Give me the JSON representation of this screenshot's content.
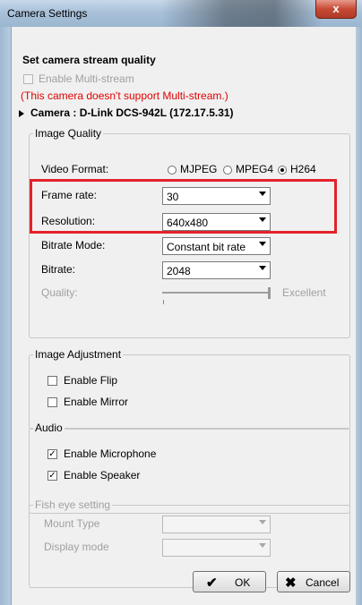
{
  "window": {
    "title": "Camera Settings",
    "close_label": "x"
  },
  "stream": {
    "heading": "Set camera stream quality",
    "multistream_label": "Enable Multi-stream",
    "multistream_warning": "(This camera doesn't support Multi-stream.)",
    "camera_label": "Camera : D-Link DCS-942L (172.17.5.31)"
  },
  "image_quality": {
    "group_title": "Image Quality",
    "video_format_label": "Video Format:",
    "formats": [
      "MJPEG",
      "MPEG4",
      "H264"
    ],
    "selected_format": "H264",
    "frame_rate_label": "Frame rate:",
    "frame_rate_value": "30",
    "resolution_label": "Resolution:",
    "resolution_value": "640x480",
    "bitrate_mode_label": "Bitrate Mode:",
    "bitrate_mode_value": "Constant bit rate",
    "bitrate_label": "Bitrate:",
    "bitrate_value": "2048",
    "quality_label": "Quality:",
    "quality_max_label": "Excellent",
    "quality_level": 1.0
  },
  "image_adjustment": {
    "group_title": "Image Adjustment",
    "flip_label": "Enable Flip",
    "flip_checked": false,
    "mirror_label": "Enable Mirror",
    "mirror_checked": false
  },
  "audio": {
    "group_title": "Audio",
    "microphone_label": "Enable Microphone",
    "microphone_checked": true,
    "speaker_label": "Enable Speaker",
    "speaker_checked": true
  },
  "fisheye": {
    "group_title": "Fish eye setting",
    "mount_type_label": "Mount Type",
    "mount_type_value": "",
    "display_mode_label": "Display mode",
    "display_mode_value": ""
  },
  "buttons": {
    "ok_label": "OK",
    "ok_icon": "check-icon",
    "cancel_label": "Cancel",
    "cancel_icon": "x-icon"
  },
  "colors": {
    "highlight": "#e3222b",
    "warning_text": "#e00000"
  }
}
